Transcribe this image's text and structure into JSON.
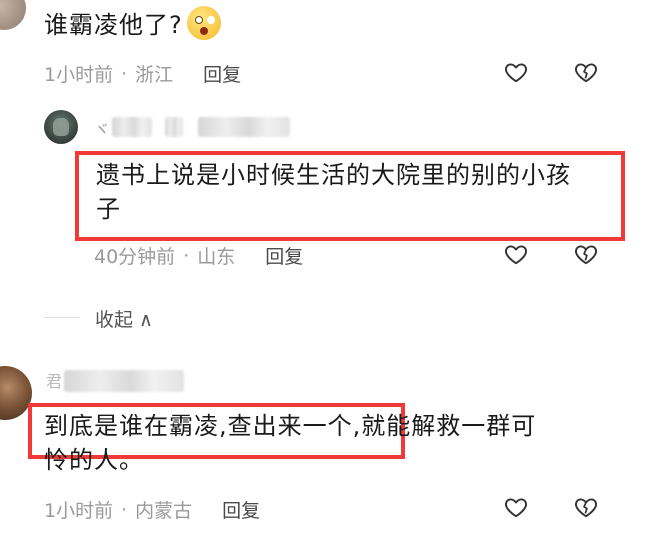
{
  "comments": [
    {
      "text": "谁霸凌他了?",
      "emoji": "shocked-face",
      "time": "1小时前",
      "location": "浙江",
      "reply_label": "回复"
    },
    {
      "username": "ヾ",
      "text_line1": "遗书上说是小时候生活的大院里的别的小孩",
      "text_line2": "子",
      "time": "40分钟前",
      "location": "山东",
      "reply_label": "回复"
    },
    {
      "username": "君",
      "text_line1_highlight": "到底是谁在霸凌,查出来一个,",
      "text_line1_rest": "就能解救一群可",
      "text_line2": "怜的人。",
      "time": "1小时前",
      "location": "内蒙古",
      "reply_label": "回复"
    }
  ],
  "collapse": {
    "label": "收起 ∧"
  },
  "separator": "·",
  "colors": {
    "highlight": "#f03a3a",
    "meta": "#9a9a9a"
  },
  "icons": [
    "like-heart-icon",
    "dislike-broken-heart-icon"
  ]
}
